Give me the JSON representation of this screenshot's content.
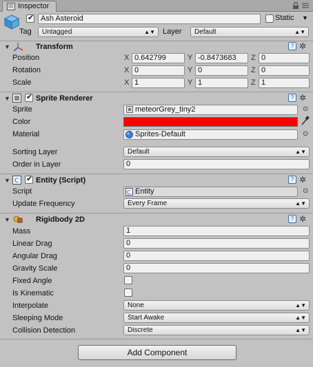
{
  "tab": {
    "label": "Inspector"
  },
  "gameobject": {
    "name": "Ash Asteroid",
    "static_label": "Static",
    "tag_label": "Tag",
    "tag_value": "Untagged",
    "layer_label": "Layer",
    "layer_value": "Default"
  },
  "transform": {
    "title": "Transform",
    "position_label": "Position",
    "position": [
      "0.642799",
      "-0.8473683",
      "0"
    ],
    "rotation_label": "Rotation",
    "rotation": [
      "0",
      "0",
      "0"
    ],
    "scale_label": "Scale",
    "scale": [
      "1",
      "1",
      "1"
    ],
    "axis": [
      "X",
      "Y",
      "Z"
    ]
  },
  "sprite_renderer": {
    "title": "Sprite Renderer",
    "sprite_label": "Sprite",
    "sprite_value": "meteorGrey_tiny2",
    "color_label": "Color",
    "color_value": "#ff0000",
    "material_label": "Material",
    "material_value": "Sprites-Default",
    "sorting_layer_label": "Sorting Layer",
    "sorting_layer_value": "Default",
    "order_label": "Order in Layer",
    "order_value": "0"
  },
  "entity": {
    "title": "Entity (Script)",
    "script_label": "Script",
    "script_value": "Entity",
    "update_label": "Update Frequency",
    "update_value": "Every Frame"
  },
  "rigidbody": {
    "title": "Rigidbody 2D",
    "mass_label": "Mass",
    "mass": "1",
    "linear_drag_label": "Linear Drag",
    "linear_drag": "0",
    "angular_drag_label": "Angular Drag",
    "angular_drag": "0",
    "gravity_label": "Gravity Scale",
    "gravity": "0",
    "fixed_angle_label": "Fixed Angle",
    "kinematic_label": "Is Kinematic",
    "interpolate_label": "Interpolate",
    "interpolate": "None",
    "sleeping_label": "Sleeping Mode",
    "sleeping": "Start Awake",
    "collision_label": "Collision Detection",
    "collision": "Discrete"
  },
  "add_component_label": "Add Component",
  "icons": [
    "lock-icon",
    "menu-icon",
    "cube-icon",
    "help-icon",
    "gear-icon",
    "transform-icon",
    "sprite-renderer-icon",
    "script-icon",
    "rigidbody-icon",
    "eyedropper-icon",
    "target-icon",
    "material-sphere-icon"
  ]
}
